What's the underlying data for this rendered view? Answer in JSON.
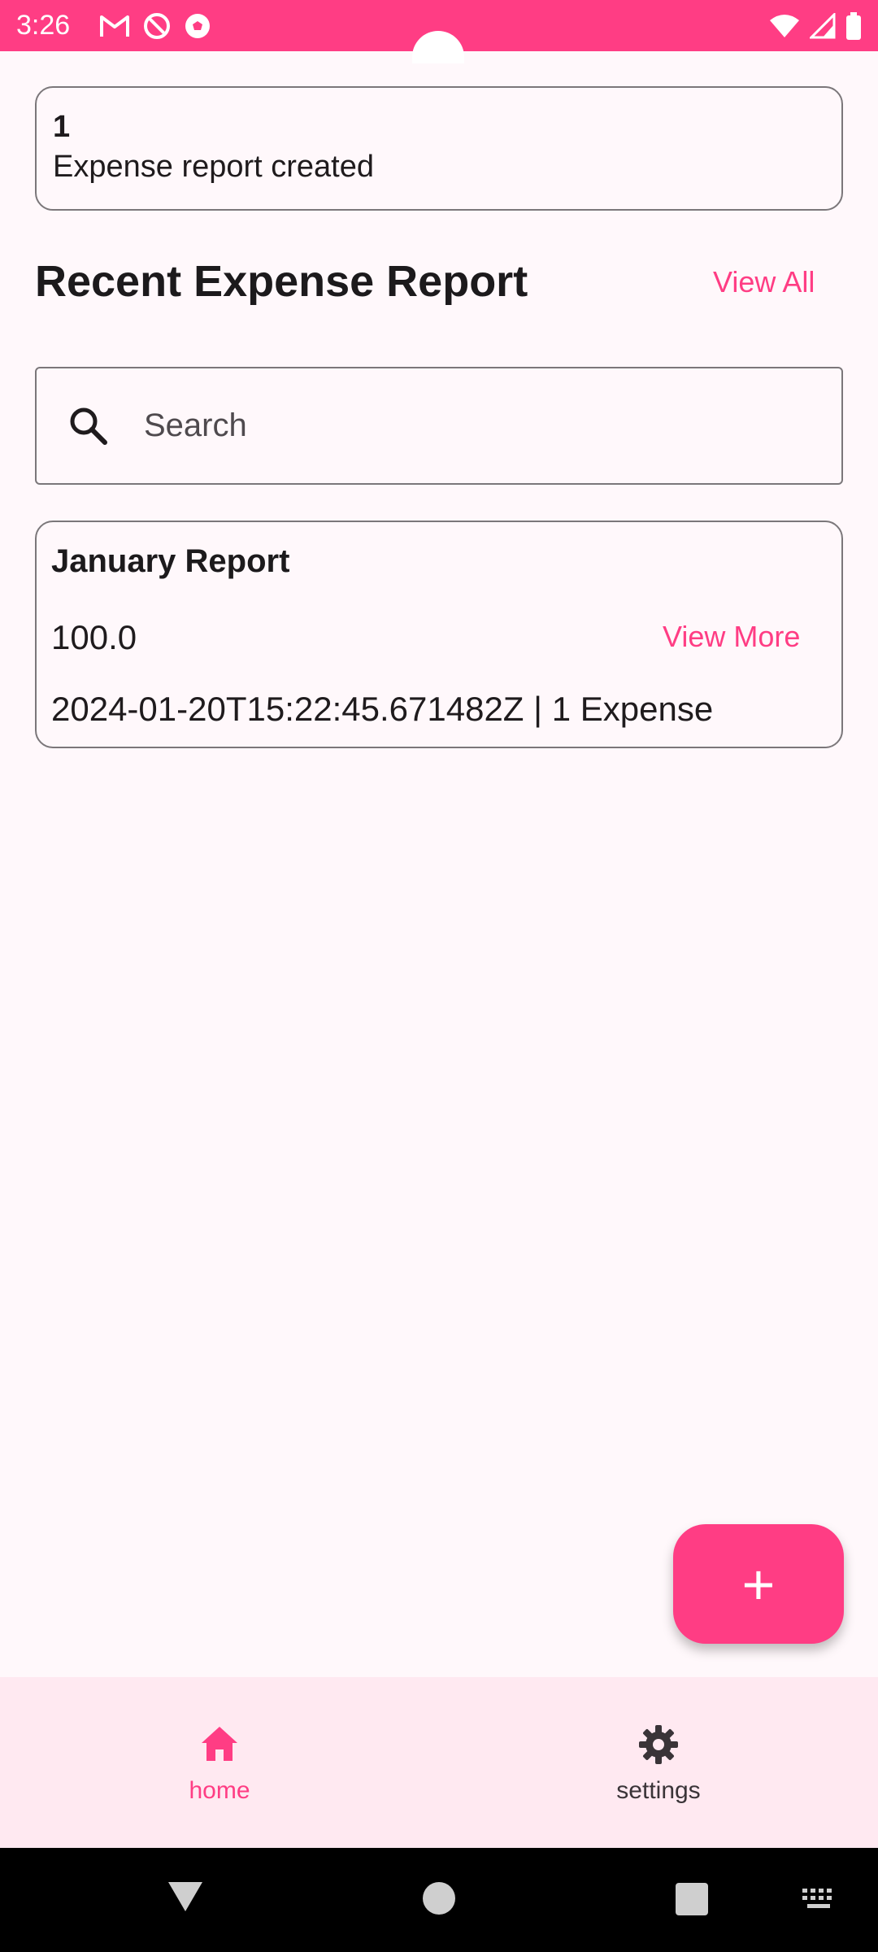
{
  "status_bar": {
    "time": "3:26",
    "icons": [
      "gmail-icon",
      "do-not-disturb-icon",
      "soccer-ball-icon",
      "wifi-icon",
      "cell-signal-icon",
      "battery-icon"
    ]
  },
  "notice": {
    "count": "1",
    "message": "Expense report created"
  },
  "section": {
    "title": "Recent Expense Report",
    "view_all_label": "View All"
  },
  "search": {
    "placeholder": "Search",
    "icon": "search-icon"
  },
  "reports": [
    {
      "title": "January Report",
      "amount": "100.0",
      "view_more_label": "View More",
      "meta": "2024-01-20T15:22:45.671482Z  |  1 Expense"
    }
  ],
  "fab": {
    "label": "+",
    "icon": "add-icon"
  },
  "bottom_nav": {
    "items": [
      {
        "label": "home",
        "icon": "home-icon",
        "active": true
      },
      {
        "label": "settings",
        "icon": "gear-icon",
        "active": false
      }
    ]
  },
  "colors": {
    "accent": "#ff3d84",
    "background": "#fff8fb",
    "nav_background": "#ffe9f1"
  }
}
